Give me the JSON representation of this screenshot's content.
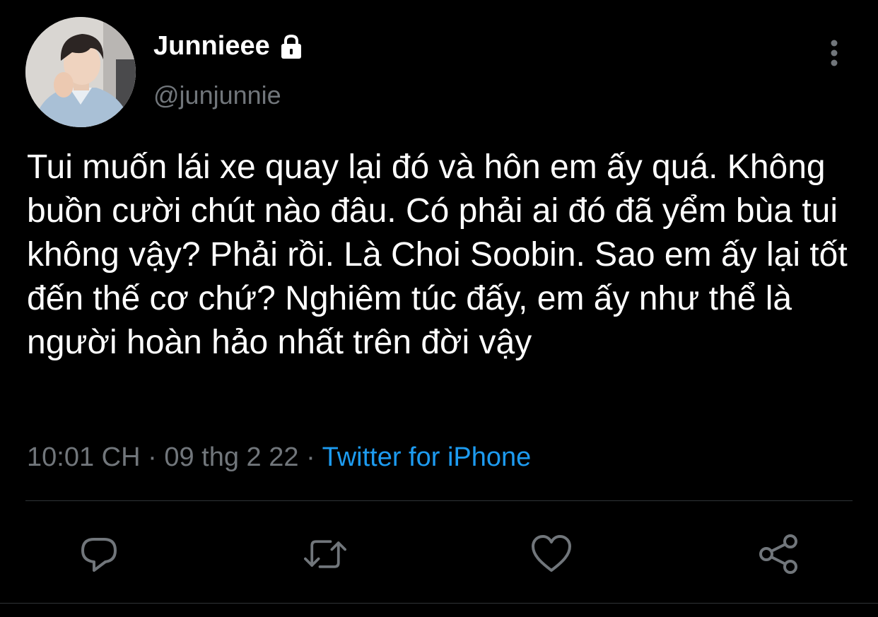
{
  "tweet": {
    "display_name": "Junnieee",
    "handle": "@junjunnie",
    "protected_icon": "lock-icon",
    "body": "Tui muốn lái xe quay lại đó và hôn em ấy quá. Không buồn cười chút nào đâu. Có phải ai đó đã yểm bùa tui không vậy? Phải rồi. Là Choi Soobin. Sao em ấy lại tốt đến thế cơ chứ? Nghiêm túc đấy, em ấy như thể là người hoàn hảo nhất trên đời vậy",
    "time": "10:01 CH",
    "date": "09 thg 2 22",
    "separator": "·",
    "source": "Twitter for iPhone"
  },
  "actions": [
    {
      "icon": "reply-icon"
    },
    {
      "icon": "retweet-icon"
    },
    {
      "icon": "like-icon"
    },
    {
      "icon": "share-icon"
    }
  ],
  "colors": {
    "background": "#000000",
    "primary_text": "#ffffff",
    "secondary_text": "#71767b",
    "link": "#1d9bf0",
    "divider": "#2f3336"
  }
}
